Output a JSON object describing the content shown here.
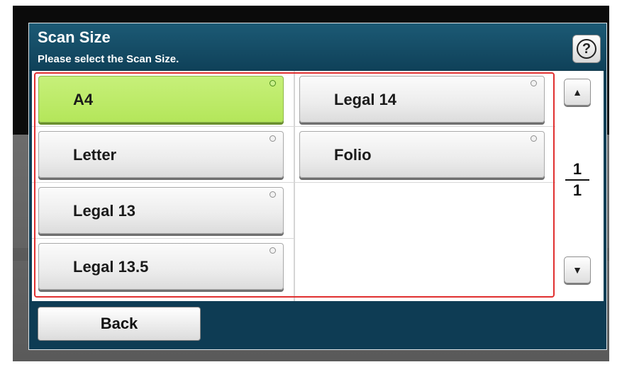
{
  "dialog": {
    "title": "Scan Size",
    "subtitle": "Please select the Scan Size.",
    "help_icon": "question-mark-icon",
    "help_label": "?"
  },
  "options": [
    {
      "label": "A4",
      "selected": true
    },
    {
      "label": "Legal 14",
      "selected": false
    },
    {
      "label": "Letter",
      "selected": false
    },
    {
      "label": "Folio",
      "selected": false
    },
    {
      "label": "Legal 13",
      "selected": false
    },
    {
      "label": "Legal 13.5",
      "selected": false
    }
  ],
  "pager": {
    "current": "1",
    "total": "1",
    "up_icon": "triangle-up-icon",
    "down_icon": "triangle-down-icon",
    "up_glyph": "▲",
    "down_glyph": "▼"
  },
  "footer": {
    "back_label": "Back"
  },
  "colors": {
    "header_bg": "#1c5a75",
    "selected_bg": "#b4e65a",
    "highlight_frame": "#e03030"
  }
}
